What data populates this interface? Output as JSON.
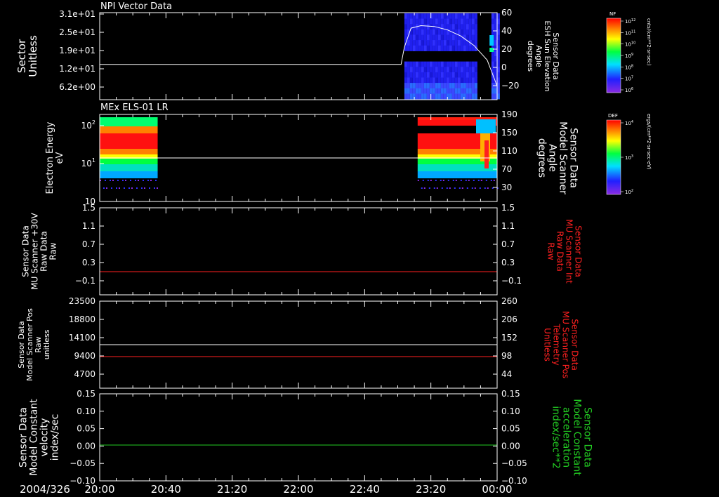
{
  "date_label": "2004/326",
  "x_ticks": [
    "20:00",
    "20:40",
    "21:20",
    "22:00",
    "22:40",
    "23:20",
    "00:00"
  ],
  "colors": {
    "background": "#000000",
    "axes": "#ffffff",
    "red": "#ff2020",
    "green": "#22cc22",
    "white": "#ffffff"
  },
  "panels": [
    {
      "title": "NPI Vector Data",
      "left_label": [
        "Sector",
        "Unitless"
      ],
      "left_ticks": [
        "3.1e+01",
        "2.5e+01",
        "1.9e+01",
        "1.2e+01",
        "6.2e+00"
      ],
      "right_label": [
        "Sensor Data",
        "ESH Sun Elevation",
        "Angle",
        "degrees"
      ],
      "right_ticks": [
        "60",
        "40",
        "20",
        "0",
        "−20"
      ]
    },
    {
      "title": "MEx ELS-01 LR",
      "left_label": [
        "Electron Energy",
        "eV"
      ],
      "left_ticks": [
        "10",
        "10",
        "10"
      ],
      "left_tick_exps": [
        "2",
        "1",
        ""
      ],
      "right_label": [
        "Sensor Data",
        "Model Scanner",
        "Angle",
        "degrees"
      ],
      "right_ticks": [
        "190",
        "150",
        "110",
        "70",
        "30"
      ]
    },
    {
      "title": "",
      "left_label": [
        "Sensor Data",
        "MU Scanner +30V",
        "Raw Data",
        "Raw"
      ],
      "left_ticks": [
        "1.5",
        "1.1",
        "0.7",
        "0.3",
        "−0.1"
      ],
      "right_label": [
        "Sensor Data",
        "MU Scanner Int",
        "Raw Data",
        "Raw"
      ],
      "right_ticks": [
        "1.5",
        "1.1",
        "0.7",
        "0.3",
        "−0.1"
      ]
    },
    {
      "title": "",
      "left_label": [
        "Sensor Data",
        "Model Scanner Pos",
        "Raw",
        "unitless"
      ],
      "left_ticks": [
        "23500",
        "18800",
        "14100",
        "9400",
        "4700"
      ],
      "right_label": [
        "Sensor Data",
        "MU Scanner Pos",
        "Telemetry",
        "Unitless"
      ],
      "right_ticks": [
        "260",
        "206",
        "152",
        "98",
        "44"
      ]
    },
    {
      "title": "",
      "left_label": [
        "Sensor Data",
        "Model Constant",
        "velocity",
        "index/sec"
      ],
      "left_ticks": [
        "0.15",
        "0.10",
        "0.05",
        "0.00",
        "−0.05",
        "−0.10"
      ],
      "right_label": [
        "Sensor Data",
        "Model Constant",
        "acceleration",
        "index/sec**2"
      ],
      "right_ticks": [
        "0.15",
        "0.10",
        "0.05",
        "0.00",
        "−0.05",
        "−0.10"
      ]
    }
  ],
  "colorbars": [
    {
      "name": "NF",
      "unit": "cnts/(cm**2-sr-sec)",
      "ticks": [
        "10",
        "10",
        "10",
        "10",
        "10",
        "10",
        "10"
      ],
      "tick_exps": [
        "12",
        "11",
        "10",
        "9",
        "8",
        "7",
        "6"
      ]
    },
    {
      "name": "DEF",
      "unit": "ergs/(cm**2-sr-sec-eV)",
      "ticks": [
        "10",
        "10",
        "10"
      ],
      "tick_exps": [
        "4",
        "3",
        "2"
      ]
    }
  ],
  "chart_data": [
    {
      "type": "line",
      "panel": 1,
      "series": [
        {
          "name": "",
          "axis": "right",
          "x": [
            "20:00",
            "23:02",
            "23:04",
            "23:08",
            "23:14",
            "23:22",
            "23:30",
            "23:38",
            "23:46",
            "23:54",
            "00:00"
          ],
          "y": [
            0,
            0,
            20,
            42,
            45,
            44,
            40,
            33,
            22,
            5,
            -25
          ]
        }
      ],
      "spectrogram": {
        "x_range": [
          "23:04",
          "00:00"
        ],
        "y_range": [
          0,
          31
        ],
        "gaps": [
          "23:48 - 23:55"
        ],
        "levels": "NF"
      },
      "ylim_left": [
        0,
        31
      ],
      "ylim_right": [
        -40,
        60
      ]
    },
    {
      "type": "heatmap",
      "panel": 2,
      "blocks": [
        {
          "x_range": [
            "20:00",
            "20:35"
          ]
        },
        {
          "x_range": [
            "23:12",
            "00:00"
          ]
        }
      ],
      "series": [
        {
          "name": "",
          "axis": "right",
          "x": [
            "20:00",
            "00:00"
          ],
          "y": [
            97,
            97
          ]
        }
      ],
      "ylim_left": [
        2,
        200
      ],
      "ylim_right": [
        10,
        190
      ],
      "yscale_left": "log"
    },
    {
      "type": "line",
      "panel": 3,
      "series": [
        {
          "name": "",
          "axis": "right",
          "x": [
            "20:00",
            "00:00"
          ],
          "y": [
            -0.05,
            -0.05
          ]
        }
      ],
      "ylim": [
        -0.4,
        1.5
      ]
    },
    {
      "type": "line",
      "panel": 4,
      "series": [
        {
          "name": "",
          "axis": "left",
          "x": [
            "20:00",
            "00:00"
          ],
          "y": [
            11700,
            11700
          ]
        },
        {
          "name": "",
          "axis": "right",
          "x": [
            "20:00",
            "00:00"
          ],
          "y": [
            88,
            88
          ]
        }
      ],
      "ylim_left": [
        0,
        23500
      ],
      "ylim_right": [
        0,
        260
      ]
    },
    {
      "type": "line",
      "panel": 5,
      "series": [
        {
          "name": "",
          "axis": "right",
          "x": [
            "20:00",
            "00:00"
          ],
          "y": [
            0,
            0
          ]
        }
      ],
      "ylim": [
        -0.1,
        0.15
      ]
    }
  ]
}
